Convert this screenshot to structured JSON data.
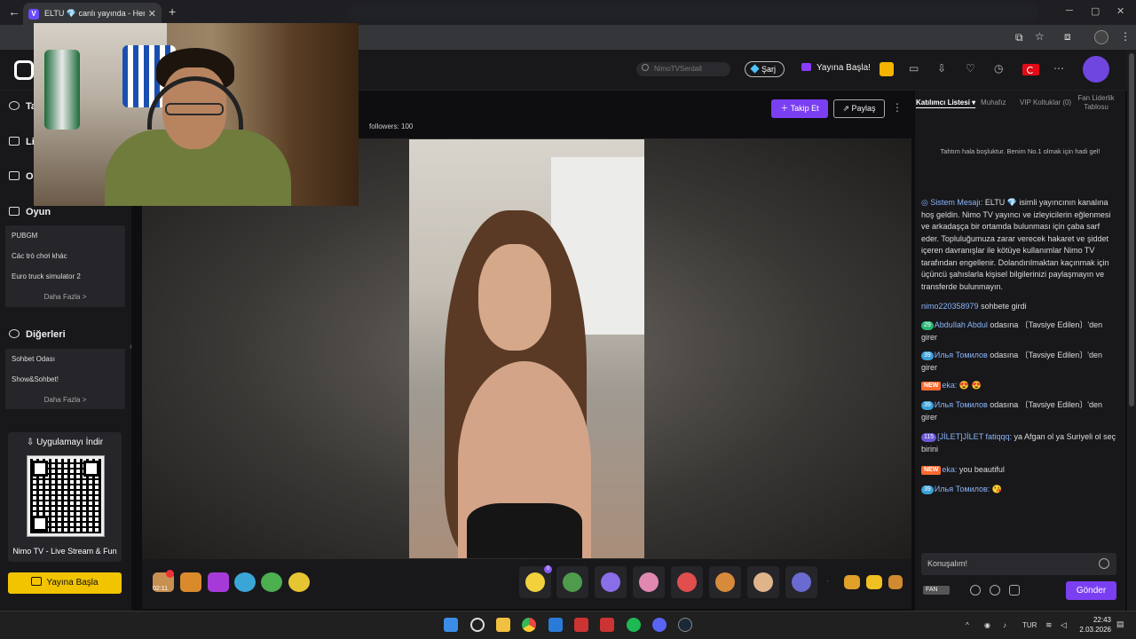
{
  "browser": {
    "tab_title": "ELTU 💎 canlı yayında - Hemen",
    "tab_favicon": "V"
  },
  "header": {
    "search_placeholder": "NimoTVSerdall",
    "sarj_label": "Şarj",
    "go_live_label": "Yayına Başla!"
  },
  "sidebar": {
    "sections": [
      {
        "title": "Ta",
        "icon": "heart-icon"
      },
      {
        "title": "Li",
        "icon": "list-icon"
      },
      {
        "title": "O",
        "icon": "shield-icon"
      }
    ],
    "game_title": "Oyun",
    "game_items": [
      "PUBGM",
      "Các trò chơi khác",
      "Euro truck simulator 2"
    ],
    "game_more": "Daha Fazla >",
    "other_title": "Diğerleri",
    "other_items": [
      "Sohbet Odası",
      "Show&Sohbet!"
    ],
    "other_more": "Daha Fazla >",
    "app_title": "Uygulamayı İndir",
    "app_name": "Nimo TV - Live Stream & Fun",
    "golive_label": "Yayına Başla"
  },
  "stream": {
    "followers": "followers: 100",
    "follow_label": "Takip Et",
    "share_label": "Paylaş"
  },
  "gifts": {
    "counter": "02:11",
    "slot_badge": "0"
  },
  "chat": {
    "tabs": [
      "Katılımcı Listesi",
      "Muhafız",
      "VIP Koltuklar (0)",
      "Fan Liderlik Tablosu"
    ],
    "empty_notice": "Tahtım hala boşluktur. Benim No.1 olmak için hadi gel!",
    "system_label": "Sistem Mesajı:",
    "system_text": "ELTU 💎 isimli yayıncının kanalına hoş geldin. Nimo TV yayıncı ve izleyicilerin eğlenmesi ve arkadaşça bir ortamda bulunması için çaba sarf eder. Topluluğumuza zarar verecek hakaret ve şiddet içeren davranışlar ile kötüye kullanımlar Nimo TV tarafından engellenir. Dolandırılmaktan kaçınmak için üçüncü şahıslarla kişisel bilgilerinizi paylaşmayın ve transferde bulunmayın.",
    "messages": [
      {
        "badge": "",
        "badge_class": "",
        "name": "nimo220358979",
        "text": " sohbete girdi"
      },
      {
        "badge": "29",
        "badge_class": "b-green",
        "name": "Abdullah Abdul",
        "text": " odasına 〔Tavsiye Edilen〕'den girer"
      },
      {
        "badge": "39",
        "badge_class": "b-blue",
        "name": "Илья Томилов",
        "text": " odasına 〔Tavsiye Edilen〕'den girer"
      },
      {
        "badge": "NEW",
        "badge_class": "b-new",
        "name": "eka:",
        "text": " 😍 😍"
      },
      {
        "badge": "39",
        "badge_class": "b-blue",
        "name": "Илья Томилов",
        "text": " odasına 〔Tavsiye Edilen〕'den girer"
      },
      {
        "badge": "115",
        "badge_class": "b-purple",
        "name": "[JİLET]JİLET fatiqqq:",
        "text": " ya Afgan ol ya Suriyeli ol seç birini"
      },
      {
        "badge": "NEW",
        "badge_class": "b-new",
        "name": "eka:",
        "text": " you beautiful"
      },
      {
        "badge": "39",
        "badge_class": "b-blue",
        "name": "Илья Томилов:",
        "text": " 😘"
      }
    ],
    "input_placeholder": "Konuşalım!",
    "fan_label": "FAN",
    "send_label": "Gönder"
  },
  "taskbar": {
    "lang": "TUR",
    "time": "22:43",
    "date": "2.03.2026"
  },
  "colors": {
    "accent": "#7b3ff2",
    "golive": "#f2c400",
    "link": "#8ab4f8"
  }
}
